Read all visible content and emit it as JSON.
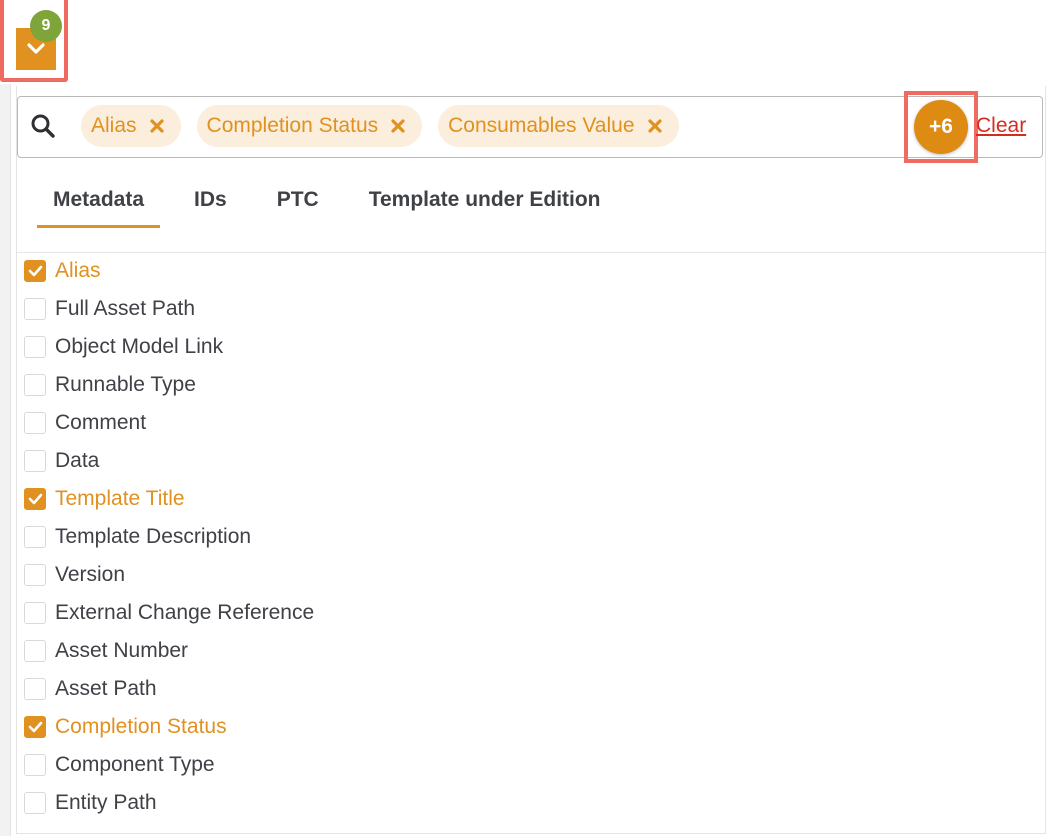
{
  "toggle": {
    "count": "9"
  },
  "search": {
    "chips": [
      {
        "label": "Alias"
      },
      {
        "label": "Completion Status"
      },
      {
        "label": "Consumables Value"
      }
    ],
    "more_label": "+6",
    "clear_label": "Clear"
  },
  "tabs": [
    {
      "label": "Metadata",
      "active": true
    },
    {
      "label": "IDs",
      "active": false
    },
    {
      "label": "PTC",
      "active": false
    },
    {
      "label": "Template under Edition",
      "active": false
    }
  ],
  "items": [
    {
      "label": "Alias",
      "checked": true
    },
    {
      "label": "Full Asset Path",
      "checked": false
    },
    {
      "label": "Object Model Link",
      "checked": false
    },
    {
      "label": "Runnable Type",
      "checked": false
    },
    {
      "label": "Comment",
      "checked": false
    },
    {
      "label": "Data",
      "checked": false
    },
    {
      "label": "Template Title",
      "checked": true
    },
    {
      "label": "Template Description",
      "checked": false
    },
    {
      "label": "Version",
      "checked": false
    },
    {
      "label": "External Change Reference",
      "checked": false
    },
    {
      "label": "Asset Number",
      "checked": false
    },
    {
      "label": "Asset Path",
      "checked": false
    },
    {
      "label": "Completion Status",
      "checked": true
    },
    {
      "label": "Component Type",
      "checked": false
    },
    {
      "label": "Entity Path",
      "checked": false
    }
  ],
  "colors": {
    "accent": "#e0911f",
    "chip_bg": "#fbeedd",
    "badge_green": "#7ea43a",
    "highlight_red": "#ef6b61",
    "clear_red": "#d62c20"
  },
  "icons": {
    "search": "search-icon",
    "toggle": "chevron-down-icon",
    "chip_remove": "close-icon",
    "check": "check-icon"
  }
}
